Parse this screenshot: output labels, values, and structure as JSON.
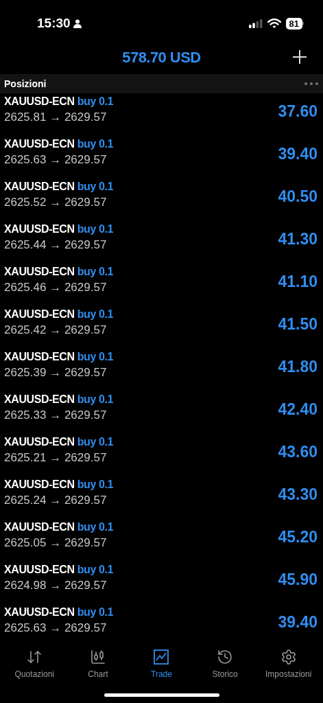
{
  "status_bar": {
    "time": "15:30",
    "battery": "81"
  },
  "header": {
    "balance": "578.70 USD"
  },
  "section": {
    "title": "Posizioni"
  },
  "positions": [
    {
      "symbol": "XAUUSD-ECN",
      "side": "buy 0.1",
      "prices": "2625.81 → 2629.57",
      "profit": "37.60"
    },
    {
      "symbol": "XAUUSD-ECN",
      "side": "buy 0.1",
      "prices": "2625.63 → 2629.57",
      "profit": "39.40"
    },
    {
      "symbol": "XAUUSD-ECN",
      "side": "buy 0.1",
      "prices": "2625.52 → 2629.57",
      "profit": "40.50"
    },
    {
      "symbol": "XAUUSD-ECN",
      "side": "buy 0.1",
      "prices": "2625.44 → 2629.57",
      "profit": "41.30"
    },
    {
      "symbol": "XAUUSD-ECN",
      "side": "buy 0.1",
      "prices": "2625.46 → 2629.57",
      "profit": "41.10"
    },
    {
      "symbol": "XAUUSD-ECN",
      "side": "buy 0.1",
      "prices": "2625.42 → 2629.57",
      "profit": "41.50"
    },
    {
      "symbol": "XAUUSD-ECN",
      "side": "buy 0.1",
      "prices": "2625.39 → 2629.57",
      "profit": "41.80"
    },
    {
      "symbol": "XAUUSD-ECN",
      "side": "buy 0.1",
      "prices": "2625.33 → 2629.57",
      "profit": "42.40"
    },
    {
      "symbol": "XAUUSD-ECN",
      "side": "buy 0.1",
      "prices": "2625.21 → 2629.57",
      "profit": "43.60"
    },
    {
      "symbol": "XAUUSD-ECN",
      "side": "buy 0.1",
      "prices": "2625.24 → 2629.57",
      "profit": "43.30"
    },
    {
      "symbol": "XAUUSD-ECN",
      "side": "buy 0.1",
      "prices": "2625.05 → 2629.57",
      "profit": "45.20"
    },
    {
      "symbol": "XAUUSD-ECN",
      "side": "buy 0.1",
      "prices": "2624.98 → 2629.57",
      "profit": "45.90"
    },
    {
      "symbol": "XAUUSD-ECN",
      "side": "buy 0.1",
      "prices": "2625.63 → 2629.57",
      "profit": "39.40"
    }
  ],
  "tab_bar": [
    {
      "kind": "quotes",
      "label": "Quotazioni",
      "selected": false
    },
    {
      "kind": "chart",
      "label": "Chart",
      "selected": false
    },
    {
      "kind": "trade",
      "label": "Trade",
      "selected": true
    },
    {
      "kind": "history",
      "label": "Storico",
      "selected": false
    },
    {
      "kind": "settings",
      "label": "Impostazioni",
      "selected": false
    }
  ]
}
